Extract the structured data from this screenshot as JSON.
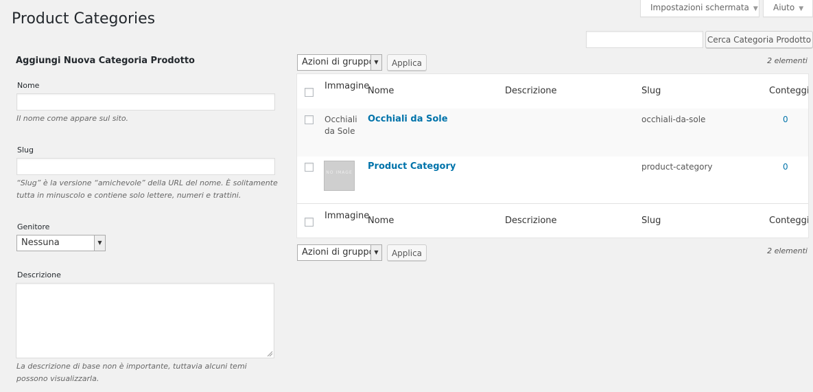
{
  "screen_options": {
    "label": "Impostazioni schermata",
    "arrow": "▼"
  },
  "help": {
    "label": "Aiuto",
    "arrow": "▼"
  },
  "page_title": "Product Categories",
  "search": {
    "value": "",
    "button_label": "Cerca Categoria Prodotto"
  },
  "form": {
    "heading": "Aggiungi Nuova Categoria Prodotto",
    "name_label": "Nome",
    "name_value": "",
    "name_desc": "Il nome come appare sul sito.",
    "slug_label": "Slug",
    "slug_value": "",
    "slug_desc": "“Slug” è la versione “amichevole” della URL del nome. È solitamente tutta in minuscolo e contiene solo lettere, numeri e trattini.",
    "parent_label": "Genitore",
    "parent_value": "Nessuna",
    "description_label": "Descrizione",
    "description_value": "",
    "description_desc": "La descrizione di base non è importante, tuttavia alcuni temi possono visualizzarla."
  },
  "bulk": {
    "select_value": "Azioni di gruppo",
    "apply_label": "Applica"
  },
  "item_count": "2 elementi",
  "table": {
    "columns": {
      "image": "Immagine",
      "name": "Nome",
      "description": "Descrizione",
      "slug": "Slug",
      "count": "Conteggio"
    },
    "rows": [
      {
        "image_text": "Occhiali da Sole",
        "name": "Occhiali da Sole",
        "description": "",
        "slug": "occhiali-da-sole",
        "count": "0"
      },
      {
        "image_text": "NO IMAGE",
        "name": "Product Category",
        "description": "",
        "slug": "product-category",
        "count": "0"
      }
    ]
  },
  "colors": {
    "link": "#0073aa",
    "background": "#f1f1f1"
  },
  "icons": {
    "dropdown": "caret-down-icon",
    "resize": "resize-handle-icon"
  }
}
